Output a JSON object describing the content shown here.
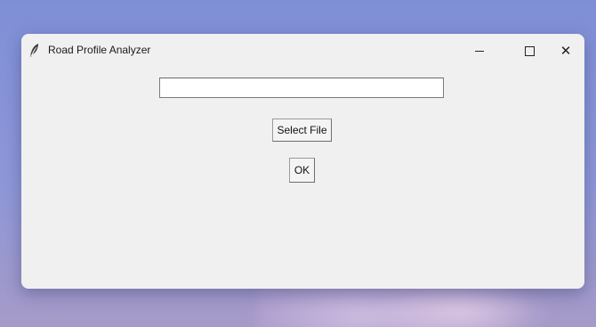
{
  "window": {
    "title": "Road Profile Analyzer",
    "icon": "feather-icon",
    "controls": {
      "minimize_icon": "minimize-icon",
      "maximize_icon": "maximize-icon",
      "close_icon": "close-icon"
    }
  },
  "form": {
    "file_path": {
      "value": "",
      "placeholder": ""
    },
    "select_file_label": "Select File",
    "ok_label": "OK"
  },
  "colors": {
    "window_background": "#f0f0f0",
    "desktop_accent": "#7f8fd6"
  }
}
